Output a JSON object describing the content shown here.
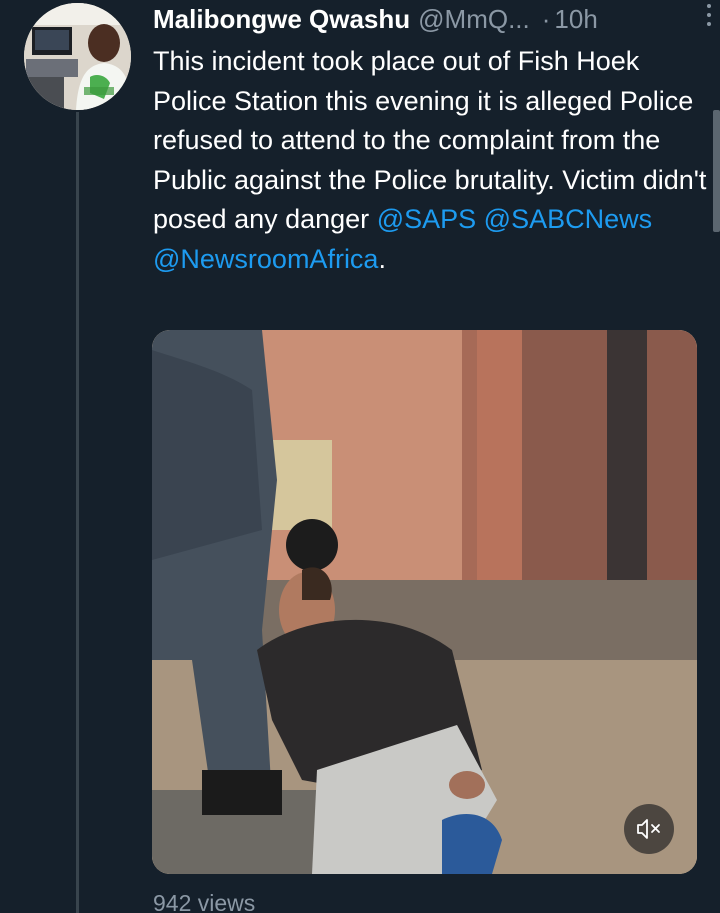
{
  "tweet": {
    "display_name": "Malibongwe Qwashu",
    "handle": "@MmQ...",
    "separator": "·",
    "time": "10h",
    "text_parts": {
      "body": "This incident took place out of Fish Hoek Police Station this evening it is alleged Police refused to attend to the complaint from the Public against the Police brutality. Victim didn't posed any danger ",
      "mention_1": "@SAPS",
      "mention_2": "@SABCNews",
      "mention_3": "@NewsroomAfrica",
      "trailing": "."
    },
    "views": "942 views"
  },
  "icons": {
    "more": "more-options-icon",
    "mute": "volume-muted-icon"
  },
  "colors": {
    "background": "#15202b",
    "text": "#ffffff",
    "secondary_text": "#8b98a5",
    "link": "#1d9bf0",
    "thread_line": "#38444d"
  }
}
